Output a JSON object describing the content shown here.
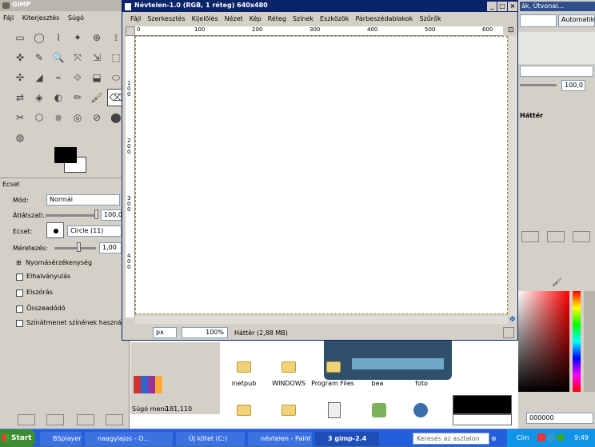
{
  "toolbox": {
    "title": "GIMP",
    "menu": [
      "Fájl",
      "Kiterjesztés",
      "Súgó"
    ]
  },
  "tool_options": {
    "title": "Ecset",
    "mode_label": "Mód:",
    "mode_value": "Normál",
    "opacity_label": "Átlátszatl.:",
    "opacity_value": "100,0",
    "brush_label": "Ecset:",
    "brush_value": "Circle (11)",
    "scale_label": "Méretezés:",
    "scale_value": "1,00",
    "pressure_label": "Nyomásérzékenység",
    "options": [
      "Elhalványulás",
      "Elszórás",
      "Összeadódó",
      "Színátmenet színének használata"
    ]
  },
  "image_window": {
    "title": "Névtelen-1.0 (RGB, 1 réteg) 640x480",
    "menu": [
      "Fájl",
      "Szerkesztés",
      "Kijelölés",
      "Nézet",
      "Kép",
      "Réteg",
      "Színek",
      "Eszközök",
      "Párbeszédablakok",
      "Szűrők"
    ],
    "ruler_top": [
      "0",
      "100",
      "200",
      "300",
      "400",
      "500",
      "600"
    ],
    "ruler_left": [
      "1\n0\n0",
      "2\n0\n0",
      "3\n0\n0",
      "4\n0\n0"
    ],
    "unit": "px",
    "zoom": "100%",
    "status": "Háttér (2,88 MB)"
  },
  "layers_panel": {
    "top_select": "Automatikus",
    "path_hint": "ák, Útvonal...",
    "opacity_value": "100,0",
    "layer_name": "Háttér"
  },
  "colors_panel": {
    "hex_value": "000000"
  },
  "behind_window": {
    "status_left": "Súgó menü",
    "coords": "181,110"
  },
  "desktop_items": [
    {
      "label": "inetpub"
    },
    {
      "label": "WINDOWS"
    },
    {
      "label": "Program Files"
    },
    {
      "label": "bea"
    },
    {
      "label": "foto"
    }
  ],
  "taskbar": {
    "start": "Start",
    "buttons": [
      "BSplayer",
      "naagylajos - O...",
      "Új kötet (C:)",
      "névtelen - Paint",
      "3 gimp-2.4"
    ],
    "search_placeholder": "Keresés az asztalon",
    "addr_label": "Cím",
    "clock": "9:49"
  },
  "colors": {
    "accent": "#0a246a",
    "taskbar": "#245edb",
    "start": "#3c8d2f"
  }
}
